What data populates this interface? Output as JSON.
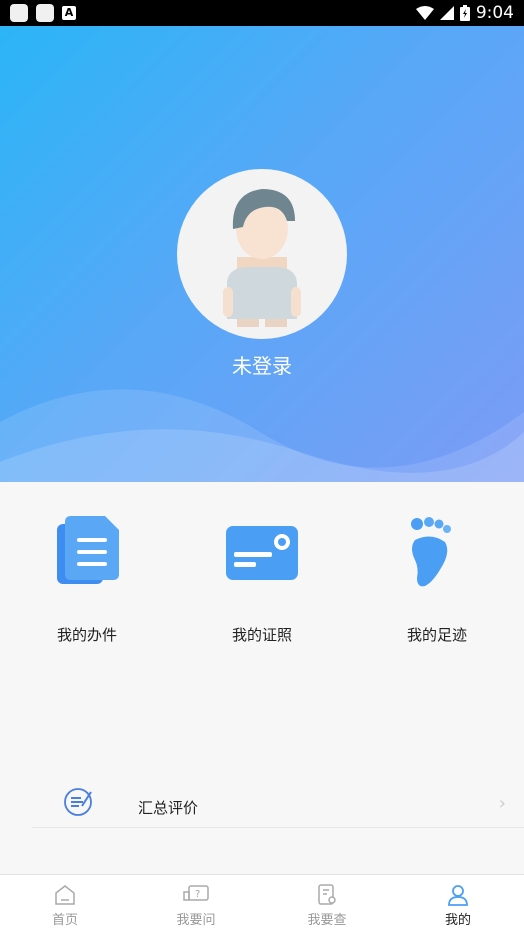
{
  "status_bar": {
    "time": "9:04",
    "letter_icon": "A"
  },
  "profile": {
    "username": "未登录"
  },
  "quick_actions": [
    {
      "label": "我的办件",
      "icon": "documents-icon"
    },
    {
      "label": "我的证照",
      "icon": "id-card-icon"
    },
    {
      "label": "我的足迹",
      "icon": "footprint-icon"
    }
  ],
  "menu_rows": [
    {
      "label": "汇总评价",
      "icon": "evaluation-icon",
      "chevron": "›"
    }
  ],
  "tab_bar": {
    "tabs": [
      {
        "label": "首页",
        "icon": "home-icon",
        "active": false
      },
      {
        "label": "我要问",
        "icon": "question-icon",
        "active": false
      },
      {
        "label": "我要查",
        "icon": "search-doc-icon",
        "active": false
      },
      {
        "label": "我的",
        "icon": "user-icon",
        "active": true
      }
    ]
  },
  "colors": {
    "accent": "#4a9ff5",
    "hero_start": "#2bb5f7",
    "hero_end": "#7c9cf6"
  }
}
